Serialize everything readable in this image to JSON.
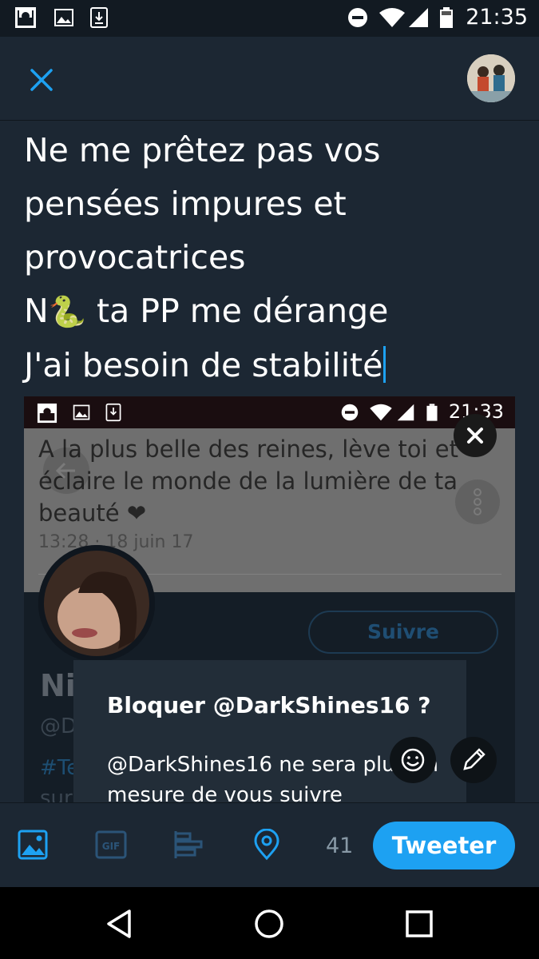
{
  "status_bar": {
    "time": "21:35",
    "icons": [
      "mosque-app-icon",
      "image-notification-icon",
      "download-icon",
      "do-not-disturb-icon",
      "wifi-icon",
      "signal-icon",
      "battery-icon"
    ]
  },
  "header": {
    "close_icon": "close-icon",
    "avatar": "profile-avatar"
  },
  "compose": {
    "lines": [
      "Ne me prêtez pas vos",
      "pensées impures et",
      "provocatrices"
    ],
    "line4_prefix": "N",
    "line4_emoji": "🐍",
    "line4_suffix": " ta PP me dérange",
    "line5": "J'ai besoin de stabilité"
  },
  "attachment": {
    "status_time": "21:33",
    "tweet_text": "A la plus belle des reines, lève toi et éclaire le monde de la lumière de ta beauté ❤",
    "tweet_date": "13:28 · 18 juin 17",
    "follow_label": "Suivre",
    "profile_name": "Ni",
    "profile_handle": "@D",
    "hashtag": "#Te",
    "bio_start": "sur",
    "dialog_title": "Bloquer @DarkShines16 ?",
    "dialog_body": "@DarkShines16 ne sera plus en mesure de vous suivre"
  },
  "toolbar": {
    "char_count": "41",
    "tweet_label": "Tweeter",
    "icons": [
      "image-icon",
      "gif-icon",
      "poll-icon",
      "location-icon"
    ],
    "accent": "#1da1f2"
  },
  "navigation": {
    "icons": [
      "back-icon",
      "home-icon",
      "recents-icon"
    ]
  }
}
